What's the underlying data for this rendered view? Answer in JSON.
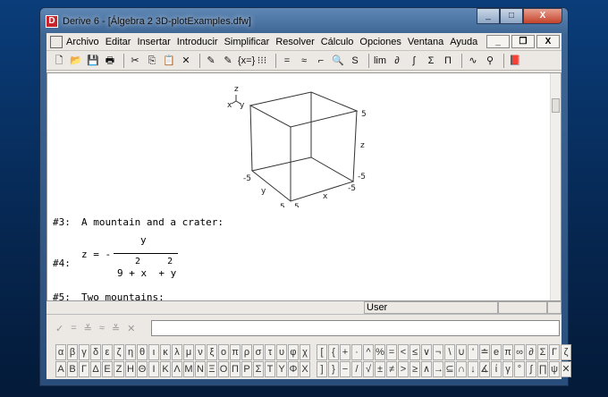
{
  "window": {
    "title": "Derive 6 - [Álgebra 2  3D-plotExamples.dfw]",
    "app_icon": "derive-icon",
    "controls": [
      "_",
      "□",
      "X"
    ]
  },
  "menu": [
    "Archivo",
    "Editar",
    "Insertar",
    "Introducir",
    "Simplificar",
    "Resolver",
    "Cálculo",
    "Opciones",
    "Ventana",
    "Ayuda"
  ],
  "mdi_controls": [
    "_",
    "❐",
    "X"
  ],
  "toolbar": [
    "🗋",
    "📂",
    "💾",
    "🖶",
    "|",
    "✂",
    "⎘",
    "📋",
    "✕",
    "|",
    "✎",
    "✎",
    "{x=}",
    "⁝⁝⁝",
    "|",
    "=",
    "≈",
    "⌐",
    "🔍",
    "S",
    "|",
    "lim",
    "∂",
    "∫",
    "Σ",
    "Π",
    "|",
    "∿",
    "⚲",
    "|",
    "📕"
  ],
  "plot": {
    "axis_glyph": {
      "z": "z",
      "x": "x",
      "y": "y"
    },
    "labels": {
      "z_top": "5",
      "z_label": "z",
      "z_bottom": "-5",
      "x_start": "-5",
      "x_label": "x",
      "x_end": "5",
      "y_start": "-5",
      "y_label": "y",
      "y_end": "5"
    }
  },
  "expressions": [
    {
      "id": "#3:",
      "text": "A mountain and a crater:"
    },
    {
      "id": "#4:",
      "lhs": "z = -",
      "numerator": "y",
      "denominator": "9 + x  + y",
      "exponents": "2     2"
    },
    {
      "id": "#5:",
      "text": "Two mountains:"
    }
  ],
  "status": {
    "mode": "User"
  },
  "entry": {
    "buttons": [
      "✓",
      "=",
      "≚",
      "≈",
      "≚",
      "✕"
    ],
    "value": ""
  },
  "greek_lower": [
    "α",
    "β",
    "γ",
    "δ",
    "ε",
    "ζ",
    "η",
    "θ",
    "ι",
    "κ",
    "λ",
    "μ",
    "ν",
    "ξ",
    "ο",
    "π",
    "ρ",
    "σ",
    "τ",
    "υ",
    "φ",
    "χ"
  ],
  "greek_upper": [
    "Α",
    "Β",
    "Γ",
    "Δ",
    "Ε",
    "Ζ",
    "Η",
    "Θ",
    "Ι",
    "Κ",
    "Λ",
    "Μ",
    "Ν",
    "Ξ",
    "Ο",
    "Π",
    "Ρ",
    "Σ",
    "Τ",
    "Υ",
    "Φ",
    "Χ"
  ],
  "ops_top": [
    "[",
    "{",
    "+",
    "·",
    "^",
    "%",
    "=",
    "<",
    "≤",
    "∨",
    "¬",
    "\\",
    "∪",
    "'",
    "≐",
    "e",
    "π",
    "∞",
    "∂",
    "Σ",
    "Γ",
    "ζ"
  ],
  "ops_bottom": [
    "]",
    "}",
    "−",
    "/",
    "√",
    "±",
    "≠",
    ">",
    "≥",
    "∧",
    "→",
    "⊆",
    "∩",
    "↓",
    "∡",
    "ί",
    "γ",
    "°",
    "∫",
    "∏",
    "ψ",
    "✕"
  ]
}
